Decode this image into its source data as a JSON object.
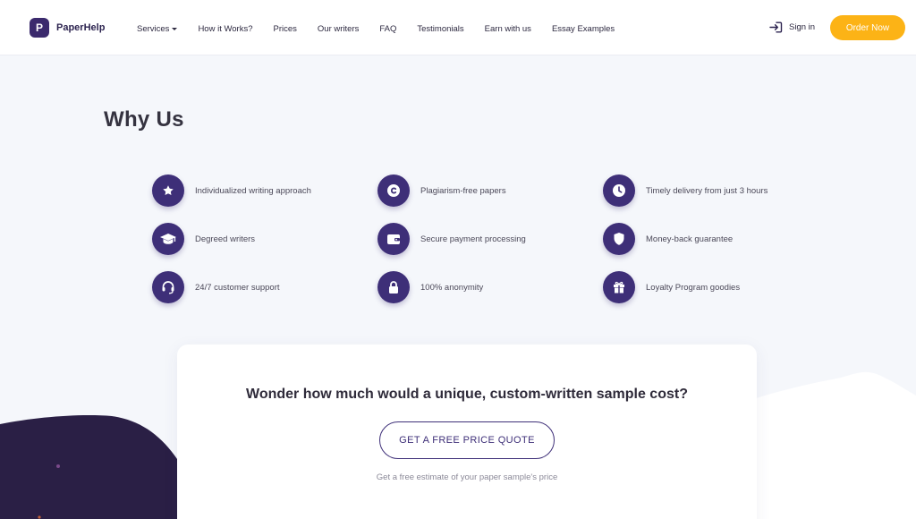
{
  "header": {
    "logo_letter": "P",
    "logo_text": "PaperHelp",
    "nav": [
      {
        "label": "Services",
        "has_caret": true
      },
      {
        "label": "How it Works?"
      },
      {
        "label": "Prices"
      },
      {
        "label": "Our writers"
      },
      {
        "label": "FAQ"
      },
      {
        "label": "Testimonials"
      },
      {
        "label": "Earn with us"
      },
      {
        "label": "Essay Examples"
      }
    ],
    "signin_label": "Sign in",
    "order_label": "Order Now"
  },
  "why": {
    "title": "Why Us",
    "features": [
      {
        "icon": "star-icon",
        "label": "Individualized writing approach"
      },
      {
        "icon": "copyright-icon",
        "label": "Plagiarism-free papers"
      },
      {
        "icon": "clock-icon",
        "label": "Timely delivery from just 3 hours"
      },
      {
        "icon": "graduation-cap-icon",
        "label": "Degreed writers"
      },
      {
        "icon": "wallet-icon",
        "label": "Secure payment processing"
      },
      {
        "icon": "shield-icon",
        "label": "Money-back guarantee"
      },
      {
        "icon": "headset-icon",
        "label": "24/7 customer support"
      },
      {
        "icon": "lock-icon",
        "label": "100% anonymity"
      },
      {
        "icon": "gift-icon",
        "label": "Loyalty Program goodies"
      }
    ]
  },
  "quote": {
    "title": "Wonder how much would a unique, custom-written sample cost?",
    "button_label": "GET A FREE PRICE QUOTE",
    "subtitle": "Get a free estimate of your paper sample's price"
  },
  "colors": {
    "accent": "#3e2f78",
    "order_button": "#fcb316",
    "background": "#f5f7fb"
  }
}
